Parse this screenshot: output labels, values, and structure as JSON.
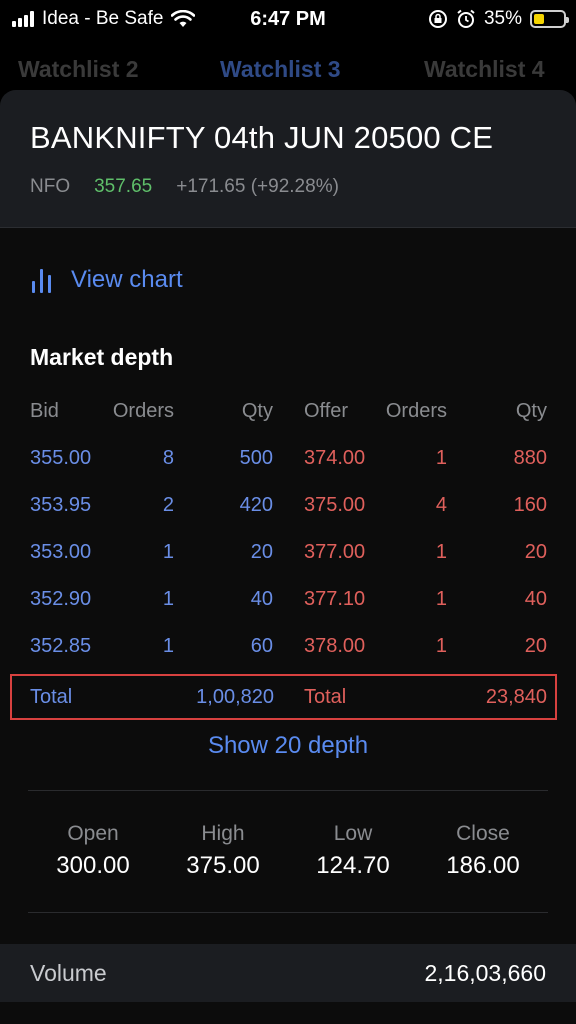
{
  "status_bar": {
    "carrier": "Idea - Be Safe",
    "time": "6:47 PM",
    "battery_percent": "35%",
    "battery_level": 0.35,
    "icons": [
      "signal-icon",
      "wifi-icon",
      "rotation-lock-icon",
      "alarm-icon",
      "battery-icon"
    ]
  },
  "tabs": [
    {
      "label": "Watchlist 2",
      "active": false
    },
    {
      "label": "Watchlist 3",
      "active": true
    },
    {
      "label": "Watchlist 4",
      "active": false
    }
  ],
  "instrument": {
    "name": "BANKNIFTY 04th JUN 20500 CE",
    "exchange": "NFO",
    "ltp": "357.65",
    "change": "+171.65 (+92.28%)"
  },
  "view_chart": {
    "label": "View chart",
    "icon": "bar-chart-icon"
  },
  "market_depth": {
    "title": "Market depth",
    "headers": {
      "bid": "Bid",
      "bid_orders": "Orders",
      "bid_qty": "Qty",
      "offer": "Offer",
      "offer_orders": "Orders",
      "offer_qty": "Qty"
    },
    "rows": [
      {
        "bid": "355.00",
        "bid_orders": "8",
        "bid_qty": "500",
        "offer": "374.00",
        "offer_orders": "1",
        "offer_qty": "880"
      },
      {
        "bid": "353.95",
        "bid_orders": "2",
        "bid_qty": "420",
        "offer": "375.00",
        "offer_orders": "4",
        "offer_qty": "160"
      },
      {
        "bid": "353.00",
        "bid_orders": "1",
        "bid_qty": "20",
        "offer": "377.00",
        "offer_orders": "1",
        "offer_qty": "20"
      },
      {
        "bid": "352.90",
        "bid_orders": "1",
        "bid_qty": "40",
        "offer": "377.10",
        "offer_orders": "1",
        "offer_qty": "40"
      },
      {
        "bid": "352.85",
        "bid_orders": "1",
        "bid_qty": "60",
        "offer": "378.00",
        "offer_orders": "1",
        "offer_qty": "20"
      }
    ],
    "total": {
      "bid_label": "Total",
      "bid_value": "1,00,820",
      "offer_label": "Total",
      "offer_value": "23,840"
    },
    "show_more": "Show 20 depth"
  },
  "ohlc": {
    "open_label": "Open",
    "open": "300.00",
    "high_label": "High",
    "high": "375.00",
    "low_label": "Low",
    "low": "124.70",
    "close_label": "Close",
    "close": "186.00"
  },
  "volume": {
    "label": "Volume",
    "value": "2,16,03,660"
  },
  "colors": {
    "bid": "#6a8ee6",
    "offer": "#e0605c",
    "ltp": "#5fbf6a",
    "accent": "#5a8bf0",
    "highlight_border": "#d8413f"
  }
}
